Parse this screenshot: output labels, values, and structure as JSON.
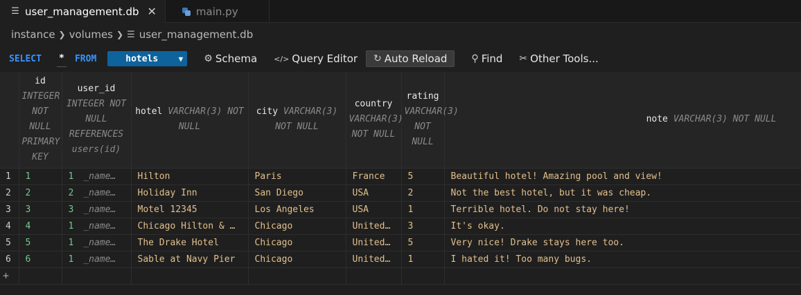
{
  "tabs": [
    {
      "label": "user_management.db",
      "active": true,
      "icon": "file-lines-icon"
    },
    {
      "label": "main.py",
      "active": false,
      "icon": "python-icon"
    }
  ],
  "breadcrumb": [
    "instance",
    "volumes",
    "user_management.db"
  ],
  "toolbar": {
    "select_kw": "SELECT",
    "star": "*",
    "from_kw": "FROM",
    "table": "hotels",
    "schema": "Schema",
    "query_editor": "Query Editor",
    "auto_reload": "Auto Reload",
    "find": "Find",
    "other_tools": "Other Tools..."
  },
  "columns": [
    {
      "name": "id",
      "type": "INTEGER NOT NULL PRIMARY KEY"
    },
    {
      "name": "user_id",
      "type": "INTEGER NOT NULL REFERENCES users(id)"
    },
    {
      "name": "hotel",
      "type": "VARCHAR(3) NOT NULL"
    },
    {
      "name": "city",
      "type": "VARCHAR(3) NOT NULL"
    },
    {
      "name": "country",
      "type": "VARCHAR(3) NOT NULL"
    },
    {
      "name": "rating",
      "type": "VARCHAR(3) NOT NULL"
    },
    {
      "name": "note",
      "type": "VARCHAR(3) NOT NULL"
    }
  ],
  "rows": [
    {
      "n": "1",
      "id": "1",
      "user_id": "1",
      "ref": "_name…",
      "hotel": "Hilton",
      "city": "Paris",
      "country": "France",
      "rating": "5",
      "note": "Beautiful hotel! Amazing pool and view!"
    },
    {
      "n": "2",
      "id": "2",
      "user_id": "2",
      "ref": "_name…",
      "hotel": "Holiday Inn",
      "city": "San Diego",
      "country": "USA",
      "rating": "2",
      "note": "Not the best hotel, but it was cheap."
    },
    {
      "n": "3",
      "id": "3",
      "user_id": "3",
      "ref": "_name…",
      "hotel": "Motel 12345",
      "city": "Los Angeles",
      "country": "USA",
      "rating": "1",
      "note": "Terrible hotel. Do not stay here!"
    },
    {
      "n": "4",
      "id": "4",
      "user_id": "1",
      "ref": "_name…",
      "hotel": "Chicago Hilton & …",
      "city": "Chicago",
      "country": "United…",
      "rating": "3",
      "note": "It's okay."
    },
    {
      "n": "5",
      "id": "5",
      "user_id": "1",
      "ref": "_name…",
      "hotel": "The Drake Hotel",
      "city": "Chicago",
      "country": "United…",
      "rating": "5",
      "note": "Very nice! Drake stays here too."
    },
    {
      "n": "6",
      "id": "6",
      "user_id": "1",
      "ref": "_name…",
      "hotel": "Sable at Navy Pier",
      "city": "Chicago",
      "country": "United…",
      "rating": "1",
      "note": "I hated it! Too many bugs."
    }
  ],
  "add_row": "+"
}
